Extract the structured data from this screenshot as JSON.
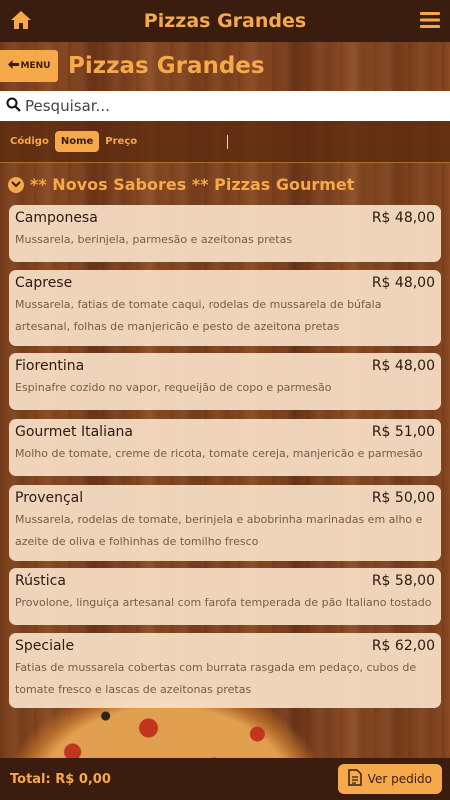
{
  "topbar": {
    "title": "Pizzas Grandes"
  },
  "header": {
    "menu_label": "MENU",
    "title": "Pizzas Grandes"
  },
  "search": {
    "placeholder": "Pesquisar..."
  },
  "sort": {
    "options": [
      {
        "label": "Código",
        "active": false
      },
      {
        "label": "Nome",
        "active": true
      },
      {
        "label": "Preço",
        "active": false
      }
    ]
  },
  "section": {
    "title": "** Novos Sabores ** Pizzas Gourmet"
  },
  "items": [
    {
      "name": "Camponesa",
      "price": "R$ 48,00",
      "desc": "Mussarela, berinjela, parmesão e azeitonas pretas"
    },
    {
      "name": "Caprese",
      "price": "R$ 48,00",
      "desc": "Mussarela, fatias de tomate caqui, rodelas de mussarela de búfala artesanal, folhas de manjericão e pesto de azeitona pretas"
    },
    {
      "name": "Fiorentina",
      "price": "R$ 48,00",
      "desc": "Espinafre cozido no vapor, requeijão de copo e parmesão"
    },
    {
      "name": "Gourmet Italiana",
      "price": "R$ 51,00",
      "desc": "Molho de tomate, creme de ricota, tomate cereja, manjericão e parmesão"
    },
    {
      "name": "Provençal",
      "price": "R$ 50,00",
      "desc": "Mussarela, rodelas de tomate, berinjela e abobrinha marinadas em alho e azeite de oliva e folhinhas de tomilho fresco"
    },
    {
      "name": "Rústica",
      "price": "R$ 58,00",
      "desc": "Provolone, linguiça artesanal com farofa temperada de pão Italiano tostado"
    },
    {
      "name": "Speciale",
      "price": "R$ 62,00",
      "desc": "Fatias de mussarela cobertas com burrata rasgada em pedaço, cubos de tomate fresco e lascas de azeitonas pretas"
    }
  ],
  "footer": {
    "total": "Total: R$ 0,00",
    "order_label": "Ver pedido"
  },
  "colors": {
    "accent": "#f6a94a",
    "bar": "#3a1d0f",
    "card": "#f8e1c8"
  },
  "icons": {
    "home": "home-icon",
    "menu": "hamburger-icon",
    "search": "search-icon",
    "back": "arrow-left-icon",
    "section": "chevron-down-icon",
    "order": "document-icon"
  }
}
